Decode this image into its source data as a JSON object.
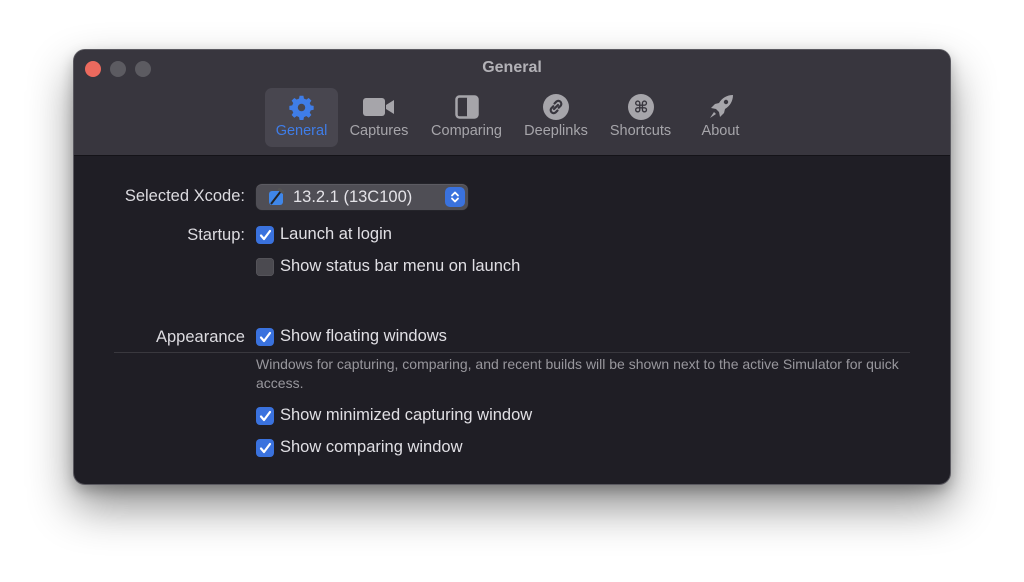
{
  "window": {
    "title": "General",
    "traffic_lights": [
      "close",
      "minimize",
      "zoom"
    ]
  },
  "toolbar": {
    "tabs": [
      {
        "id": "general",
        "label": "General",
        "icon": "gear-icon",
        "active": true
      },
      {
        "id": "captures",
        "label": "Captures",
        "icon": "video-camera-icon",
        "active": false
      },
      {
        "id": "comparing",
        "label": "Comparing",
        "icon": "split-view-icon",
        "active": false
      },
      {
        "id": "deeplinks",
        "label": "Deeplinks",
        "icon": "link-icon",
        "active": false
      },
      {
        "id": "shortcuts",
        "label": "Shortcuts",
        "icon": "command-icon",
        "active": false
      },
      {
        "id": "about",
        "label": "About",
        "icon": "rocket-icon",
        "active": false
      }
    ],
    "accent_color": "#3f7de8"
  },
  "settings": {
    "xcode": {
      "label": "Selected Xcode:",
      "value": "13.2.1 (13C100)"
    },
    "startup": {
      "label": "Startup:",
      "options": [
        {
          "label": "Launch at login",
          "checked": true
        },
        {
          "label": "Show status bar menu on launch",
          "checked": false
        }
      ]
    },
    "appearance": {
      "label": "Appearance",
      "options": [
        {
          "label": "Show floating windows",
          "checked": true
        },
        {
          "label": "Show minimized capturing window",
          "checked": true
        },
        {
          "label": "Show comparing window",
          "checked": true
        }
      ],
      "help_text": "Windows for capturing, comparing, and recent builds will be shown next to the active Simulator for quick access."
    }
  }
}
